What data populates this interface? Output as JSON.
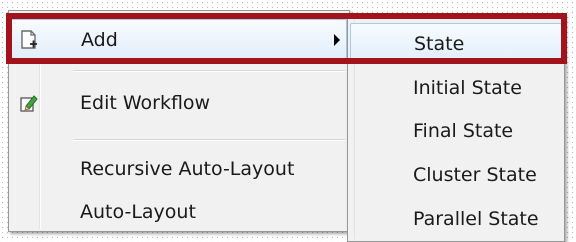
{
  "context_menu": {
    "items": [
      {
        "label": "Add",
        "icon": "add-page-icon",
        "has_submenu": true
      },
      {
        "label": "Edit Workflow",
        "icon": "pencil-edit-icon"
      },
      {
        "label": "Recursive Auto-Layout"
      },
      {
        "label": "Auto-Layout"
      }
    ]
  },
  "submenu": {
    "items": [
      {
        "label": "State"
      },
      {
        "label": "Initial State"
      },
      {
        "label": "Final State"
      },
      {
        "label": "Cluster State"
      },
      {
        "label": "Parallel State"
      }
    ]
  },
  "colors": {
    "highlight_frame": "#a3131c",
    "hover_bg": "#e2eefb",
    "hover_border": "#a8c8ec",
    "menu_bg": "#f1f1f1"
  }
}
